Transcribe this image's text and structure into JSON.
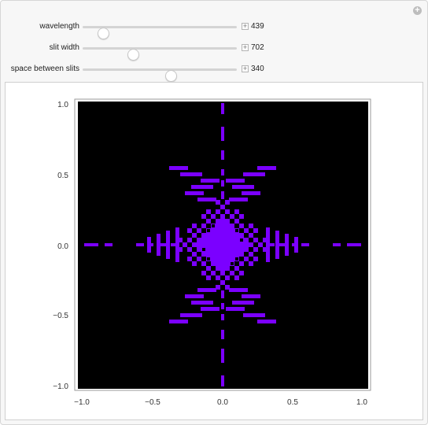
{
  "controls": [
    {
      "label": "wavelength",
      "value": "439",
      "fraction": 0.135
    },
    {
      "label": "slit width",
      "value": "702",
      "fraction": 0.335
    },
    {
      "label": "space between slits",
      "value": "340",
      "fraction": 0.59
    }
  ],
  "plot": {
    "background": "#000000",
    "pattern_color": "#7b00ff",
    "x_ticks": [
      "−1.0",
      "−0.5",
      "0.0",
      "0.5",
      "1.0"
    ],
    "y_ticks": [
      "1.0",
      "0.5",
      "0.0",
      "−0.5",
      "−1.0"
    ],
    "xlim": [
      -1.0,
      1.0
    ],
    "ylim": [
      -1.0,
      1.0
    ]
  }
}
